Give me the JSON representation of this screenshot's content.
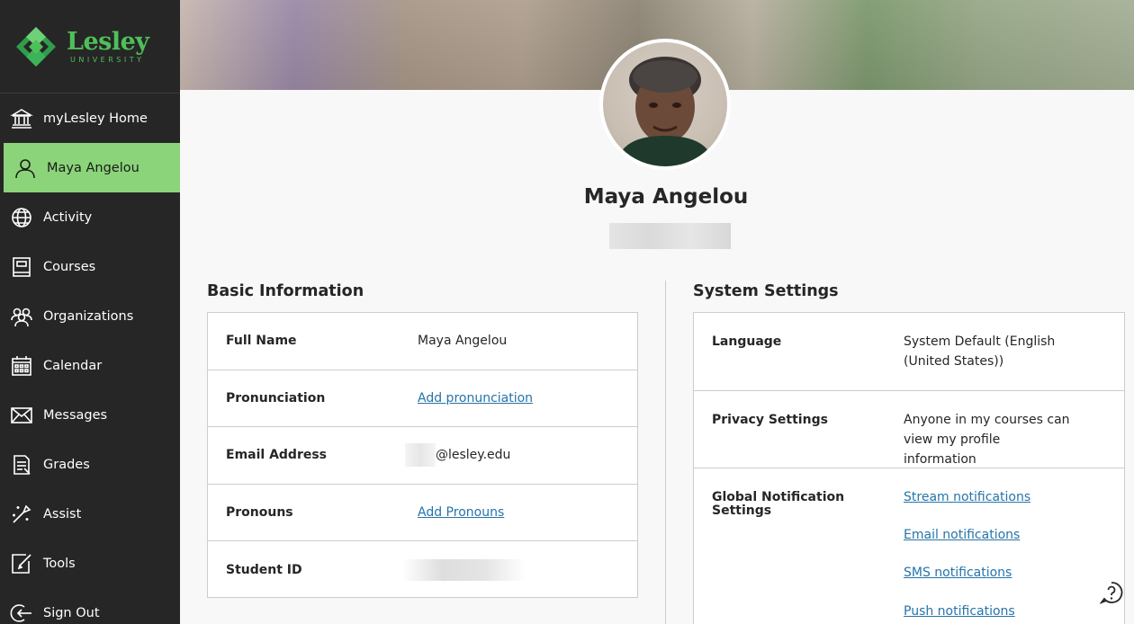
{
  "brand": {
    "name": "Lesley",
    "subtitle": "UNIVERSITY",
    "accent": "#4fbf5a"
  },
  "nav": {
    "items": [
      {
        "label": "myLesley Home",
        "icon": "institution-icon"
      },
      {
        "label": "Maya Angelou",
        "icon": "user-icon",
        "active": true
      },
      {
        "label": "Activity",
        "icon": "globe-icon"
      },
      {
        "label": "Courses",
        "icon": "book-icon"
      },
      {
        "label": "Organizations",
        "icon": "group-icon"
      },
      {
        "label": "Calendar",
        "icon": "calendar-icon"
      },
      {
        "label": "Messages",
        "icon": "envelope-icon"
      },
      {
        "label": "Grades",
        "icon": "grades-icon"
      },
      {
        "label": "Assist",
        "icon": "assist-icon"
      },
      {
        "label": "Tools",
        "icon": "tools-icon"
      },
      {
        "label": "Sign Out",
        "icon": "sign-out-icon"
      }
    ],
    "active_color": "#8bd47a"
  },
  "profile": {
    "name": "Maya Angelou"
  },
  "basic": {
    "title": "Basic Information",
    "rows": [
      {
        "label": "Full Name",
        "value": "Maya Angelou"
      },
      {
        "label": "Pronunciation",
        "link": "Add pronunciation"
      },
      {
        "label": "Email Address",
        "value": "@lesley.edu"
      },
      {
        "label": "Pronouns",
        "link": "Add Pronouns"
      },
      {
        "label": "Student ID",
        "value": ""
      }
    ]
  },
  "system": {
    "title": "System Settings",
    "language": {
      "label": "Language",
      "value": "System Default (English (United States))"
    },
    "privacy": {
      "label": "Privacy Settings",
      "value": "Anyone in my courses can view my profile information"
    },
    "notifications": {
      "label": "Global Notification Settings",
      "links": [
        "Stream notifications",
        "Email notifications",
        "SMS notifications",
        "Push notifications"
      ]
    }
  },
  "link_color": "#2574a9"
}
